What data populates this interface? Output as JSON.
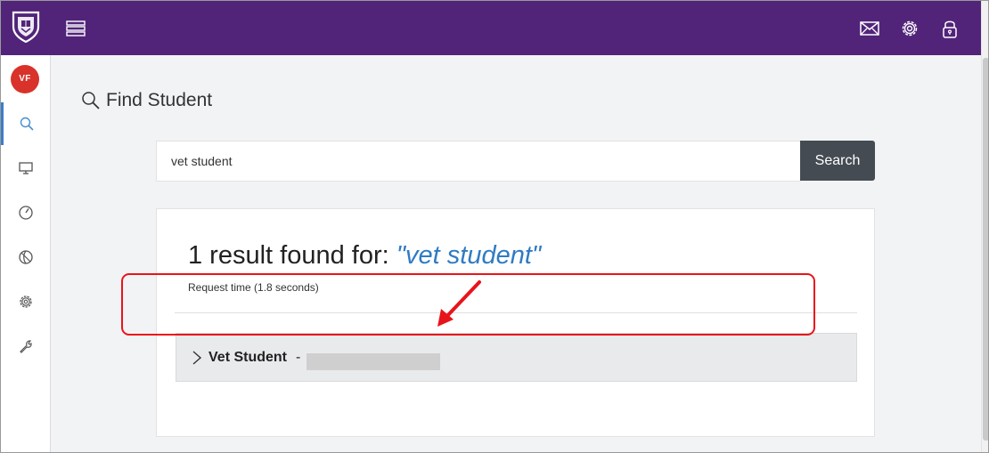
{
  "user": {
    "initials": "VF"
  },
  "sidebar": {
    "items": [
      {
        "name": "search",
        "active": true
      },
      {
        "name": "display"
      },
      {
        "name": "dashboard"
      },
      {
        "name": "globe"
      },
      {
        "name": "settings"
      },
      {
        "name": "tools"
      }
    ]
  },
  "page": {
    "title": "Find Student"
  },
  "search": {
    "value": "vet student",
    "button_label": "Search"
  },
  "results": {
    "heading_prefix": "1 result found for: ",
    "query_display": "\"vet student\"",
    "request_time": "Request time (1.8 seconds)",
    "items": [
      {
        "name": "Vet Student",
        "separator": "-"
      }
    ]
  },
  "colors": {
    "topbar": "#51247a",
    "avatar": "#d8322b",
    "accent": "#2f7bc4",
    "button": "#444b53",
    "annotation": "#e8141b"
  },
  "icons": [
    "university-crest-icon",
    "menu-icon",
    "mail-icon",
    "gear-icon",
    "lock-icon",
    "search-icon",
    "monitor-icon",
    "dashboard-icon",
    "globe-icon",
    "settings-icon",
    "wrench-icon",
    "chevron-right-icon"
  ]
}
